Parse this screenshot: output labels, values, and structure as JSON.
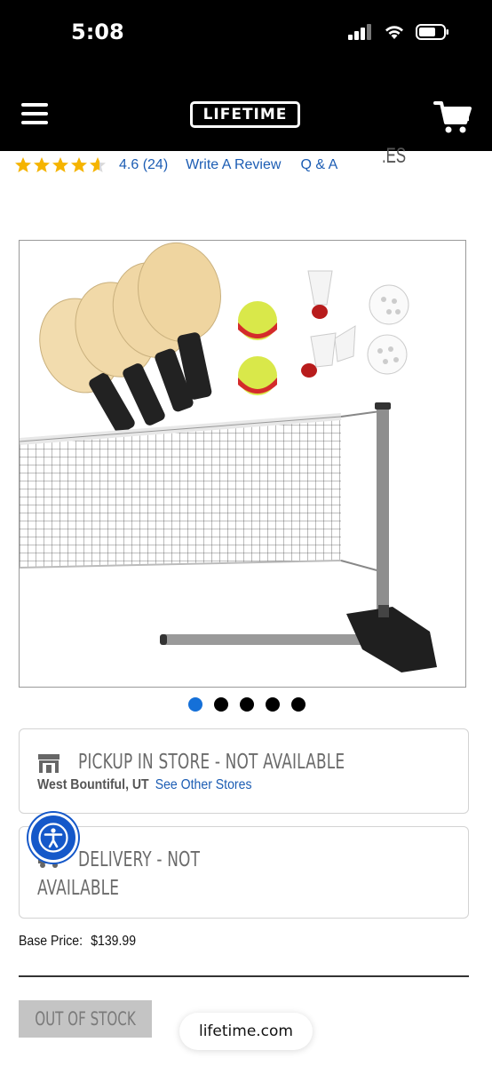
{
  "status_bar": {
    "time": "5:08"
  },
  "header": {
    "logo_text": "LIFETIME",
    "menu_icon": "hamburger-icon",
    "cart_icon": "cart-icon"
  },
  "reviews": {
    "rating": 4.6,
    "rating_text": "4.6 (24)",
    "review_count": 24,
    "write_review": "Write A Review",
    "qa": "Q & A",
    "overflow_tab_fragment": ".ES"
  },
  "gallery": {
    "image_count": 5,
    "active_index": 0
  },
  "pickup": {
    "title": "PICKUP IN STORE - NOT AVAILABLE",
    "location": "West Bountiful, UT",
    "see_other_stores": "See Other Stores",
    "icon": "store-icon"
  },
  "delivery": {
    "title_line1": "DELIVERY - NOT",
    "title_line2": "AVAILABLE",
    "icon": "truck-icon"
  },
  "price": {
    "label": "Base Price:",
    "value": "$139.99"
  },
  "cta": {
    "label": "OUT OF STOCK"
  },
  "browser": {
    "url": "lifetime.com"
  },
  "colors": {
    "link": "#1c5db4",
    "star": "#f5b400",
    "active_dot": "#1570d8",
    "accessibility": "#1558c9"
  }
}
